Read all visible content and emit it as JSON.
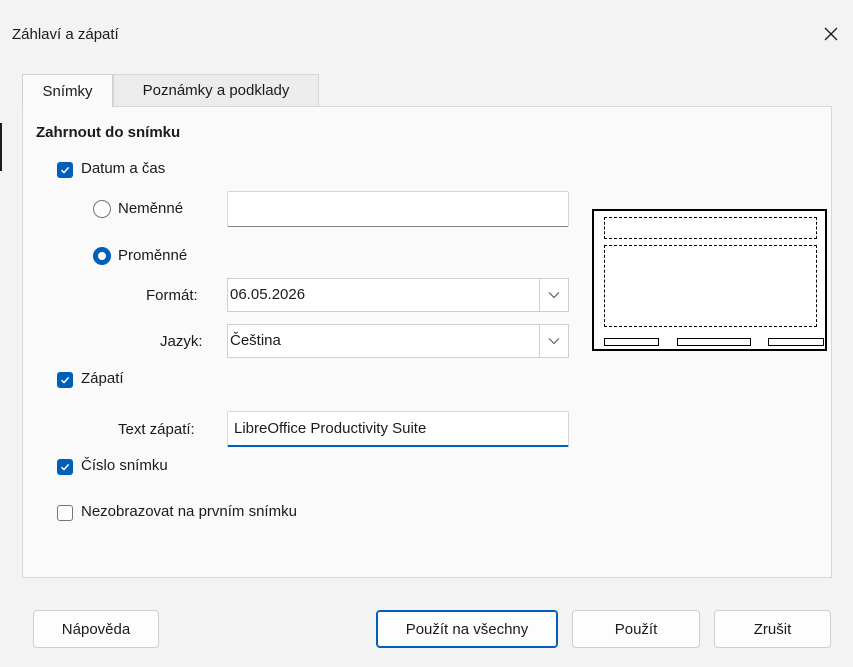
{
  "window": {
    "title": "Záhlaví a zápatí",
    "close_icon": "close-icon"
  },
  "tabs": [
    {
      "label": "Snímky",
      "active": true
    },
    {
      "label": "Poznámky a podklady",
      "active": false
    }
  ],
  "section": {
    "title": "Zahrnout do snímku"
  },
  "date_time": {
    "label": "Datum a čas",
    "checked": true,
    "fixed": {
      "label": "Neměnné",
      "value": "",
      "selected": false
    },
    "variable": {
      "label": "Proměnné",
      "selected": true
    },
    "format": {
      "label": "Formát:",
      "value": "06.05.2026"
    },
    "language": {
      "label": "Jazyk:",
      "value": "Čeština"
    }
  },
  "footer": {
    "label": "Zápatí",
    "checked": true,
    "text_label": "Text zápatí:",
    "text_value": "LibreOffice Productivity Suite"
  },
  "slide_number": {
    "label": "Číslo snímku",
    "checked": true
  },
  "hide_first": {
    "label": "Nezobrazovat na prvním snímku",
    "checked": false
  },
  "buttons": {
    "help": "Nápověda",
    "apply_all": "Použít na všechny",
    "apply": "Použít",
    "cancel": "Zrušit"
  },
  "colors": {
    "accent": "#005fb8"
  }
}
